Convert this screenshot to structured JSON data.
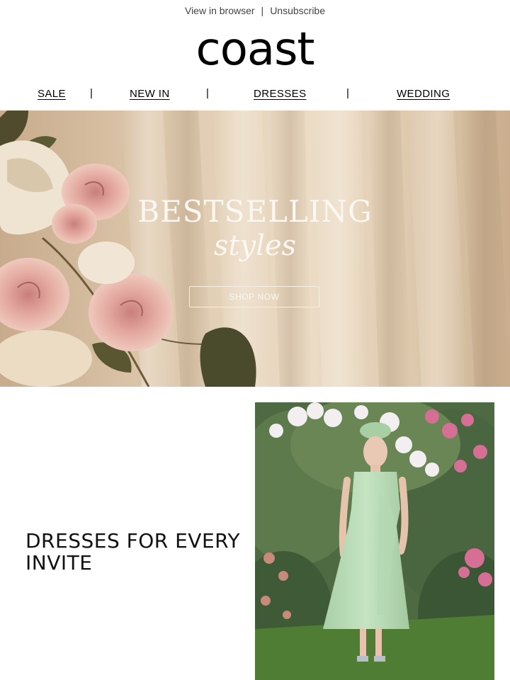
{
  "header": {
    "view_in_browser": "View in browser",
    "separator": "|",
    "unsubscribe": "Unsubscribe",
    "logo": "coast"
  },
  "nav": {
    "items": [
      "SALE",
      "NEW IN",
      "DRESSES",
      "WEDDING"
    ],
    "separator": "|"
  },
  "hero": {
    "title": "BESTSELLING",
    "subtitle": "styles",
    "button_label": "SHOP NOW",
    "image_subject": "pink roses against cream draped fabric"
  },
  "section": {
    "title": "DRESSES FOR EVERY INVITE",
    "image_subject": "woman in mint green midi dress and fascinator in front of flowering bushes"
  },
  "colors": {
    "text": "#111111",
    "hero_text": "#fbf7f1",
    "dress_green": "#b9dcb7"
  }
}
